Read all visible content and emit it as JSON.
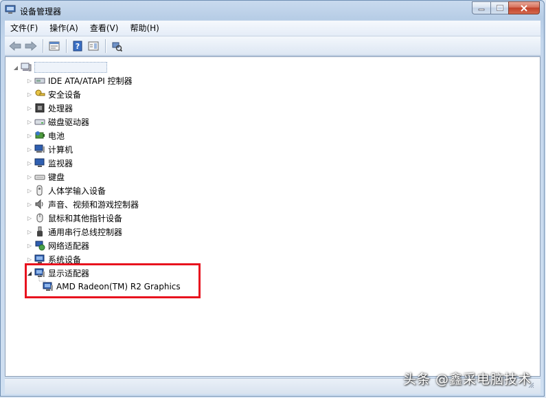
{
  "window": {
    "title": "设备管理器"
  },
  "menu": [
    {
      "label": "文件(F)"
    },
    {
      "label": "操作(A)"
    },
    {
      "label": "查看(V)"
    },
    {
      "label": "帮助(H)"
    }
  ],
  "toolbar": {
    "buttons": [
      "back-arrow-icon",
      "forward-arrow-icon",
      "properties-icon",
      "help-icon",
      "action-pane-icon",
      "scan-hardware-icon"
    ]
  },
  "tree": {
    "root_label": "",
    "categories": [
      {
        "label": "IDE ATA/ATAPI 控制器",
        "icon": "ide-controller-icon",
        "expanded": false
      },
      {
        "label": "安全设备",
        "icon": "security-device-icon",
        "expanded": false
      },
      {
        "label": "处理器",
        "icon": "processor-icon",
        "expanded": false
      },
      {
        "label": "磁盘驱动器",
        "icon": "disk-drive-icon",
        "expanded": false
      },
      {
        "label": "电池",
        "icon": "battery-icon",
        "expanded": false
      },
      {
        "label": "计算机",
        "icon": "computer-icon",
        "expanded": false
      },
      {
        "label": "监视器",
        "icon": "monitor-icon",
        "expanded": false
      },
      {
        "label": "键盘",
        "icon": "keyboard-icon",
        "expanded": false
      },
      {
        "label": "人体学输入设备",
        "icon": "hid-icon",
        "expanded": false
      },
      {
        "label": "声音、视频和游戏控制器",
        "icon": "sound-icon",
        "expanded": false
      },
      {
        "label": "鼠标和其他指针设备",
        "icon": "mouse-icon",
        "expanded": false
      },
      {
        "label": "通用串行总线控制器",
        "icon": "usb-icon",
        "expanded": false
      },
      {
        "label": "网络适配器",
        "icon": "network-adapter-icon",
        "expanded": false
      },
      {
        "label": "系统设备",
        "icon": "system-device-icon",
        "expanded": false
      },
      {
        "label": "显示适配器",
        "icon": "display-adapter-icon",
        "expanded": true
      }
    ],
    "display_adapter_child": {
      "label": "AMD Radeon(TM) R2 Graphics",
      "icon": "display-adapter-icon"
    }
  },
  "watermark": "头条 @鑫采电脑技术",
  "colors": {
    "highlight_box": "#e8121e",
    "title_bar": "#c9daee"
  }
}
